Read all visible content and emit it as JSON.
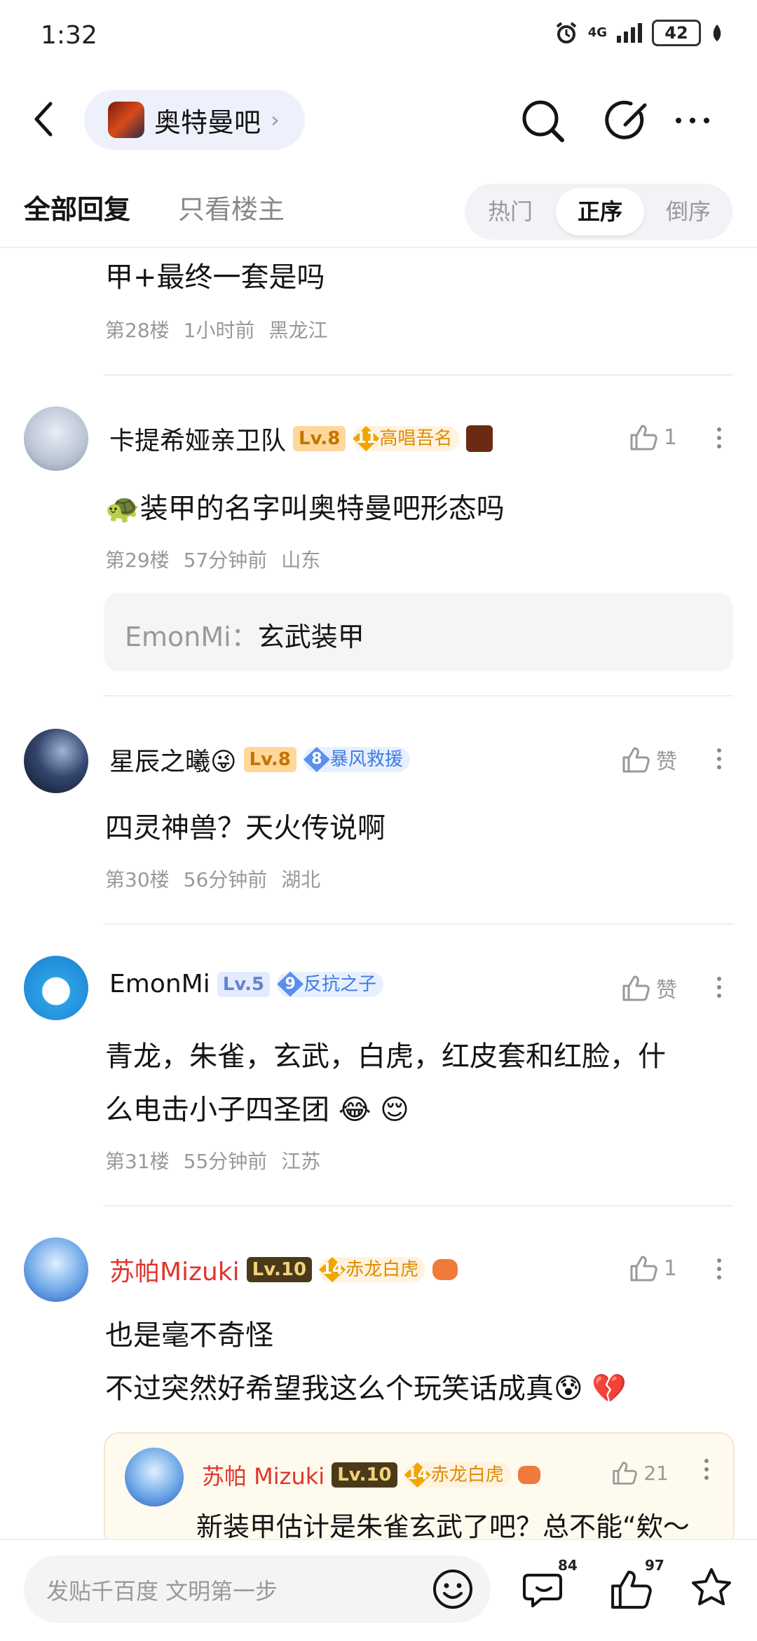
{
  "status_bar": {
    "time": "1:32",
    "network": "4G",
    "battery": "42"
  },
  "nav": {
    "forum_name": "奥特曼吧"
  },
  "tabs": {
    "all": "全部回复",
    "op_only": "只看楼主",
    "sort": [
      "热门",
      "正序",
      "倒序"
    ],
    "sort_active": "正序"
  },
  "posts": [
    {
      "content": "甲+最终一套是吗",
      "floor": "第28楼",
      "time": "1小时前",
      "location": "黑龙江"
    },
    {
      "username": "卡提希娅亲卫队",
      "level": "Lv.8",
      "badge_num": "11",
      "badge_title": "高唱吾名",
      "likes": "1",
      "content": "🐢装甲的名字叫奥特曼吧形态吗",
      "floor": "第29楼",
      "time": "57分钟前",
      "location": "山东",
      "quote_author": "EmonMi：",
      "quote_text": "玄武装甲"
    },
    {
      "username": "星辰之曦😜",
      "level": "Lv.8",
      "badge_num": "8",
      "badge_title": "暴风救援",
      "likes": "赞",
      "content": "四灵神兽？天火传说啊",
      "floor": "第30楼",
      "time": "56分钟前",
      "location": "湖北"
    },
    {
      "username": "EmonMi",
      "level": "Lv.5",
      "badge_num": "9",
      "badge_title": "反抗之子",
      "likes": "赞",
      "content_line1": "青龙，朱雀，玄武，白虎，红皮套和红脸，什",
      "content_line2": "么电击小子四圣团 😂 😌",
      "floor": "第31楼",
      "time": "55分钟前",
      "location": "江苏"
    },
    {
      "username": "苏帕Mizuki",
      "level": "Lv.10",
      "badge_num": "14",
      "badge_title": "赤龙白虎",
      "likes": "1",
      "content_line1": "也是毫不奇怪",
      "content_line2": "不过突然好希望我这么个玩笑话成真😰 💔",
      "reply": {
        "username": "苏帕 Mizuki",
        "level": "Lv.10",
        "badge_num": "14",
        "badge_title": "赤龙白虎",
        "likes": "21",
        "content": "新装甲估计是朱雀玄武了吧？总不能“欸～"
      }
    }
  ],
  "bottom_bar": {
    "placeholder": "发贴千百度 文明第一步",
    "comment_count": "84",
    "like_count": "97"
  },
  "colors": {
    "vip_red": "#e0352b",
    "badge_orange": "#e08a00",
    "badge_blue": "#3d7be0"
  }
}
